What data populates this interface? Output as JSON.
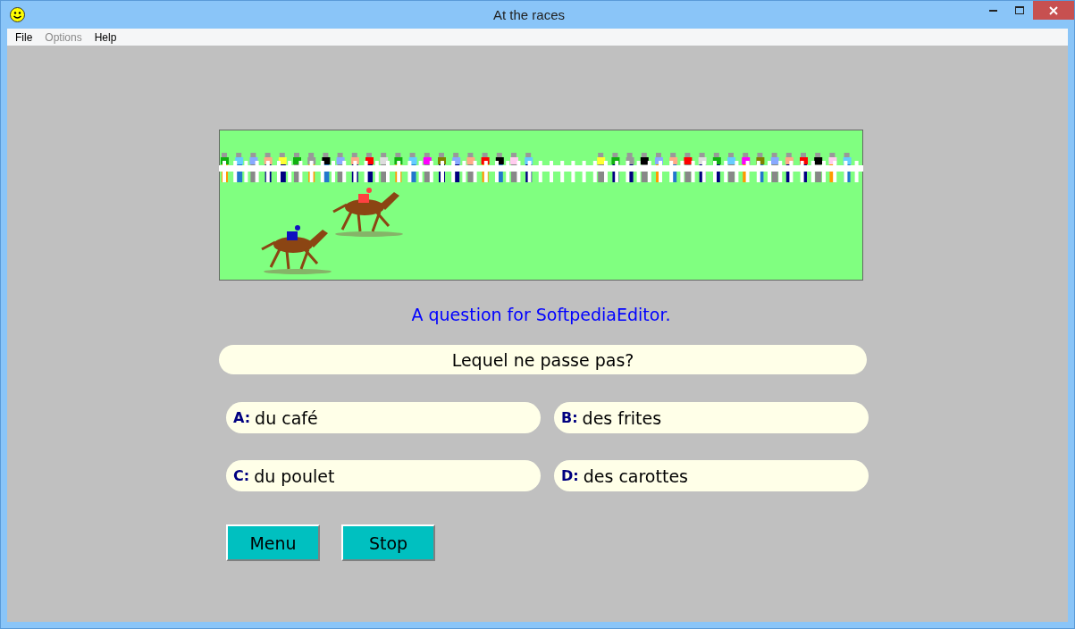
{
  "window": {
    "title": "At the races"
  },
  "menu": [
    {
      "label": "File",
      "disabled": false
    },
    {
      "label": "Options",
      "disabled": true
    },
    {
      "label": "Help",
      "disabled": false
    }
  ],
  "prompt": "A question for SoftpediaEditor.",
  "question": "Lequel ne passe pas?",
  "answers": [
    {
      "letter": "A:",
      "text": "du café"
    },
    {
      "letter": "B:",
      "text": "des frites"
    },
    {
      "letter": "C:",
      "text": "du poulet"
    },
    {
      "letter": "D:",
      "text": "des carottes"
    }
  ],
  "buttons": [
    "Menu",
    "Stop"
  ]
}
